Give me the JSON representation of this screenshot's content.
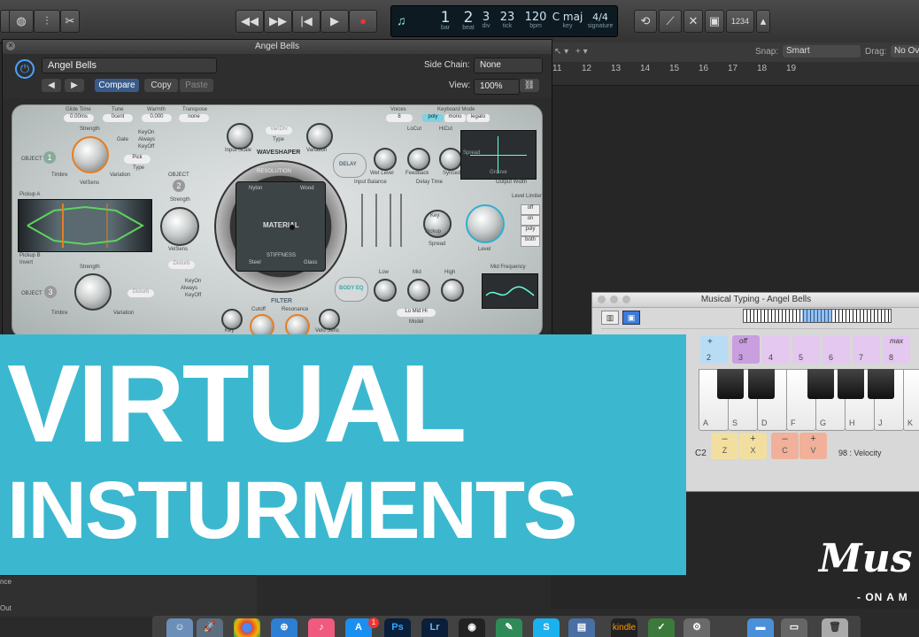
{
  "toolbar": {
    "lcd": {
      "bar": "1",
      "beat": "2",
      "div": "3",
      "tick": "23",
      "bpm": "120",
      "key": "C maj",
      "signature": "4/4"
    },
    "lcd_labels": {
      "bar": "bar",
      "beat": "beat",
      "div": "div",
      "tick": "tick",
      "bpm": "bpm",
      "key": "key",
      "signature": "signature"
    },
    "count_label": "1234"
  },
  "tracks": {
    "snap_label": "Snap:",
    "snap_value": "Smart",
    "drag_label": "Drag:",
    "drag_value": "No Ov",
    "ruler": [
      "11",
      "12",
      "13",
      "14",
      "15",
      "16",
      "17",
      "18",
      "19"
    ]
  },
  "plugin": {
    "window_title": "Angel Bells",
    "preset": "Angel Bells",
    "side_chain_label": "Side Chain:",
    "side_chain_value": "None",
    "compare": "Compare",
    "copy": "Copy",
    "paste": "Paste",
    "view_label": "View:",
    "view_value": "100%",
    "top_params": [
      {
        "label": "Glide Time",
        "value": "0.00ms"
      },
      {
        "label": "Tune",
        "value": "0cent"
      },
      {
        "label": "Warmth",
        "value": "0.000"
      },
      {
        "label": "Transpose",
        "value": "none"
      }
    ],
    "voices_label": "Voices",
    "voices_value": "8",
    "keyboard_mode_label": "Keyboard Mode",
    "modes": [
      "poly",
      "mono",
      "legato"
    ],
    "labels": {
      "object1": "OBJECT",
      "object2": "OBJECT",
      "object3": "OBJECT",
      "strength": "Strength",
      "timbre": "Timbre",
      "variation": "Variation",
      "velsens": "VelSens",
      "keyon": "KeyOn",
      "always": "Always",
      "keyoff": "KeyOff",
      "gate": "Gate",
      "type": "Type",
      "pick": "Pick",
      "disturb": "Disturb",
      "waveshaper": "WAVESHAPER",
      "vandu": "VariDrv",
      "input_scale": "Input Scale",
      "variation2": "Variation",
      "resolution": "RESOLUTION",
      "material": "MATERIAL",
      "nylon": "Nylon",
      "wood": "Wood",
      "steel": "Steel",
      "glass": "Glass",
      "stiffness": "STIFFNESS",
      "delay": "DELAY",
      "lo_cut": "LoCut",
      "hi_cut": "HiCut",
      "wet_level": "Wet Level",
      "feedback": "Feedback",
      "sync": "Synced",
      "spread": "Spread",
      "groove": "Groove",
      "input_balance": "Input Balance",
      "delay_time": "Delay Time",
      "output_width": "Output Width",
      "key": "Key",
      "pickup": "Pickup",
      "level": "Level",
      "level_limiter": "Level Limiter",
      "off": "off",
      "on": "on",
      "poly": "poly",
      "both": "both",
      "mid_frequency": "Mid Frequency",
      "body_eq": "BODY EQ",
      "low": "Low",
      "mid": "Mid",
      "high": "High",
      "model": "Lo Mid Hi",
      "model_label": "Model",
      "filter": "FILTER",
      "cutoff": "Cutoff",
      "resonance": "Resonance",
      "key_short": "Key",
      "velo_sens": "Velo Sens",
      "pickup_a": "Pickup A",
      "pickup_b": "Pickup B",
      "invert": "Invert"
    }
  },
  "musical_typing": {
    "title": "Musical Typing - Angel Bells",
    "pads": [
      {
        "top": "+",
        "bottom": "2"
      },
      {
        "top": "off",
        "bottom": "3"
      },
      {
        "top": "",
        "bottom": "4"
      },
      {
        "top": "",
        "bottom": "5"
      },
      {
        "top": "",
        "bottom": "6"
      },
      {
        "top": "",
        "bottom": "7"
      },
      {
        "top": "max",
        "bottom": "8"
      }
    ],
    "white_keys": [
      "A",
      "S",
      "D",
      "F",
      "G",
      "H",
      "J",
      "K"
    ],
    "octave": "C2",
    "controls": [
      {
        "a": "–",
        "k": "Z"
      },
      {
        "a": "+",
        "k": "X"
      },
      {
        "a": "–",
        "k": "C"
      },
      {
        "a": "+",
        "k": "V"
      }
    ],
    "velocity": "98 : Velocity"
  },
  "left_strip": {
    "a": "nce",
    "b": "Out"
  },
  "banner": {
    "line1": "VIRTUAL",
    "line2": "INSTURMENTS"
  },
  "logo": {
    "main": "Mus",
    "sub": "- ON A M"
  },
  "dock": {
    "kindle": "kindle",
    "ps": "Ps",
    "lr": "Lr",
    "badge": "1"
  },
  "colors": {
    "banner": "#3bb8cf",
    "pad_blue": "#b9dcf5",
    "pad_purple": "#c99fe0",
    "pad_pink": "#e4c8ef",
    "ctl_yellow": "#f2dfa0",
    "ctl_orange": "#f0b09a"
  }
}
